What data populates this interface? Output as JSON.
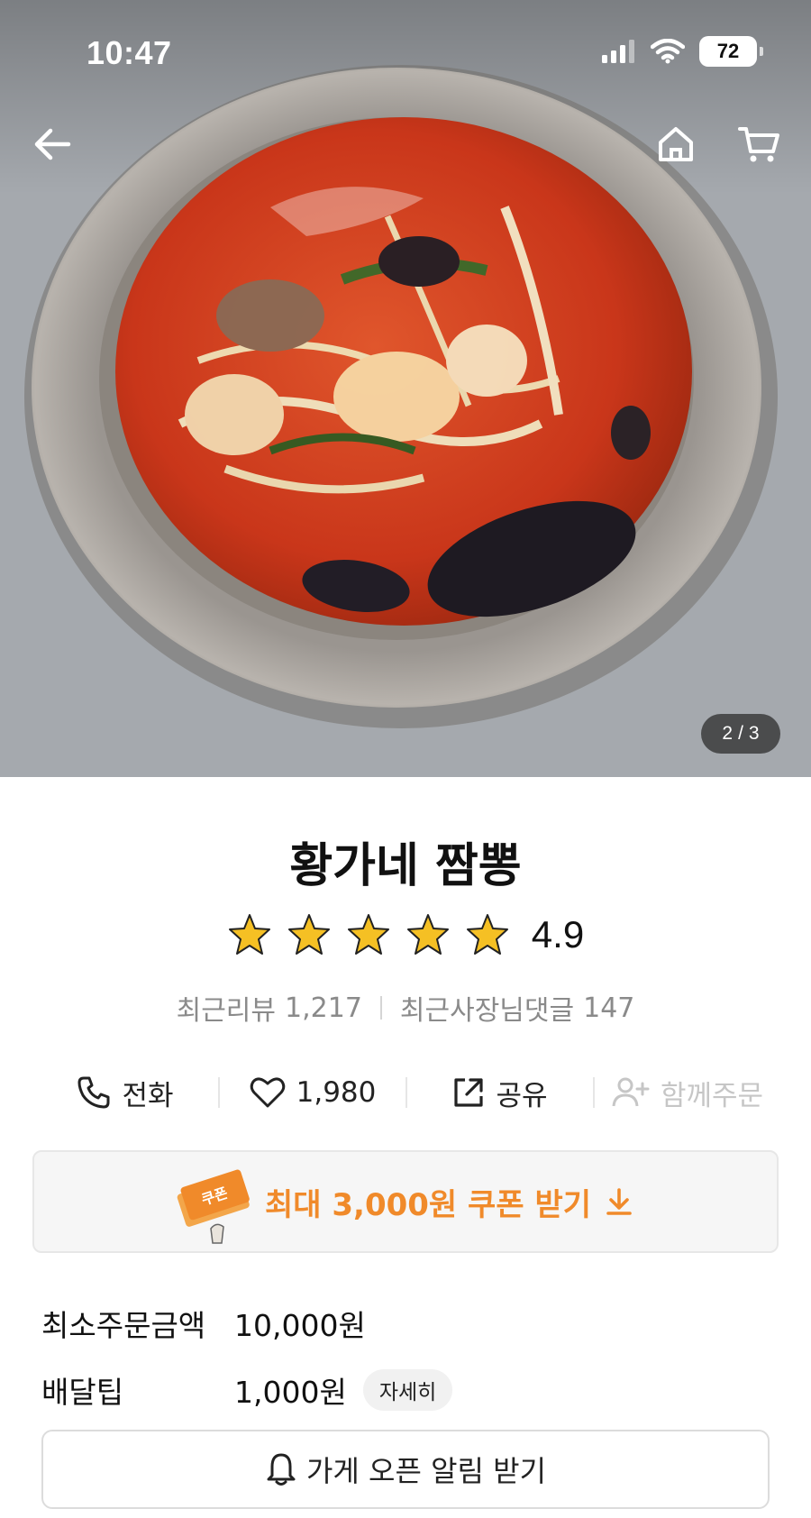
{
  "status_bar": {
    "time": "10:47",
    "battery": "72"
  },
  "hero": {
    "current_page": "2",
    "page_separator": "/",
    "total_pages": "3"
  },
  "store": {
    "name": "황가네 짬뽕",
    "rating": "4.9",
    "star_count": 5,
    "recent_reviews_label": "최근리뷰",
    "recent_reviews_count": "1,217",
    "owner_replies_label": "최근사장님댓글",
    "owner_replies_count": "147"
  },
  "actions": {
    "call_label": "전화",
    "likes_count": "1,980",
    "share_label": "공유",
    "group_order_label": "함께주문"
  },
  "coupon": {
    "label": "최대 3,000원 쿠폰 받기",
    "badge_text": "쿠폰"
  },
  "delivery": {
    "min_order_label": "최소주문금액",
    "min_order_value": "10,000원",
    "tip_label": "배달팁",
    "tip_value": "1,000원",
    "detail_label": "자세히"
  },
  "open_alert": {
    "label": "가게 오픈 알림 받기"
  },
  "colors": {
    "accent_orange": "#f08a2a",
    "star_yellow": "#f5c024",
    "muted_text": "#8a8a8a"
  }
}
